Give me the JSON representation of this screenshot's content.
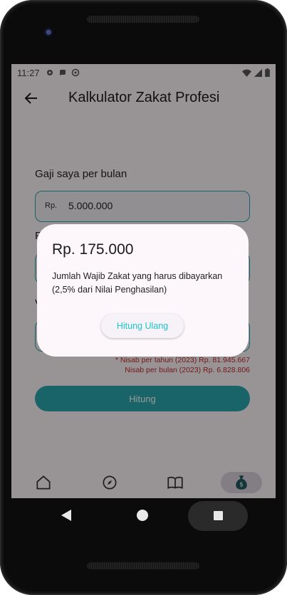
{
  "status_bar": {
    "time": "11:27",
    "left_icons": [
      "gear-icon",
      "notification-icon",
      "at-icon"
    ],
    "right_icons": [
      "wifi-icon",
      "signal-icon",
      "battery-icon"
    ]
  },
  "app_bar": {
    "title": "Kalkulator Zakat Profesi"
  },
  "form": {
    "salary_label": "Gaji saya per bulan",
    "salary_prefix": "Rp.",
    "salary_value": "5.000.000",
    "field2_label_visible": "P",
    "field3_label_visible": "V",
    "nisab_year": "* Nisab per tahun (2023) Rp. 81.945.667",
    "nisab_month": "Nisab per bulan (2023) Rp. 6.828.806",
    "calculate_button": "Hitung"
  },
  "bottom_nav": {
    "items": [
      "home-icon",
      "compass-icon",
      "book-icon",
      "money-bag-icon"
    ],
    "active": "money-bag-icon"
  },
  "dialog": {
    "amount": "Rp. 175.000",
    "description": "Jumlah Wajib Zakat yang harus dibayarkan (2,5% dari Nilai Penghasilan)",
    "recalc_button": "Hitung Ulang"
  },
  "colors": {
    "accent": "#2aa7ad",
    "accent_text": "#19c7d0",
    "warning": "#c62828",
    "surface": "#fdf7fb"
  }
}
